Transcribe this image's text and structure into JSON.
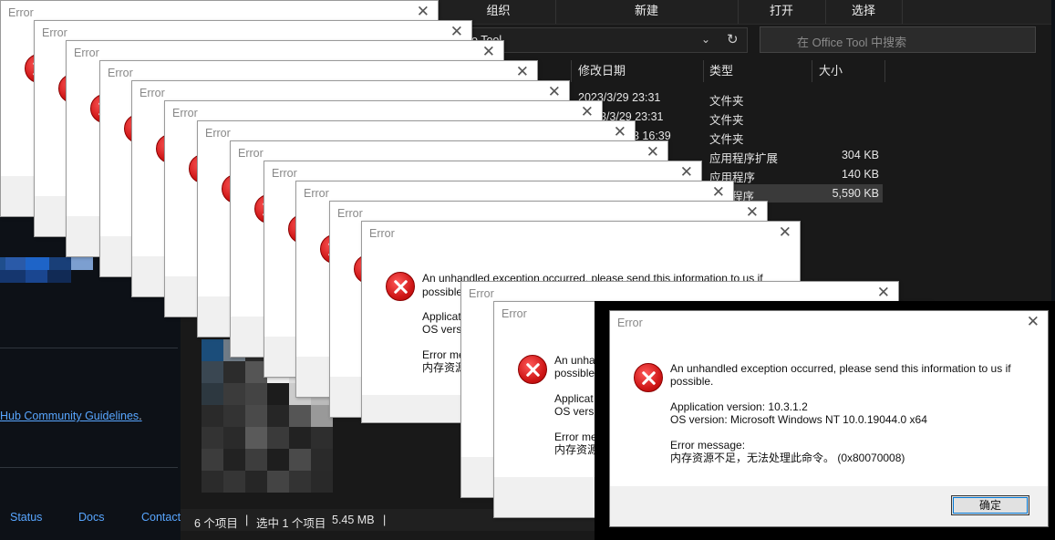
{
  "web": {
    "guideline_link": "Hub Community Guidelines",
    "guideline_dot": ".",
    "footer": [
      "Status",
      "Docs",
      "Contact"
    ]
  },
  "explorer": {
    "commands": [
      "组织",
      "新建",
      "打开",
      "选择"
    ],
    "address_text": "o Tool",
    "search_placeholder": "在 Office Tool 中搜索",
    "columns": {
      "modified": "修改日期",
      "type": "类型",
      "size": "大小"
    },
    "rows": [
      {
        "modified": "2023/3/29 23:31",
        "type": "文件夹",
        "size": ""
      },
      {
        "modified": "3/3/29 23:31",
        "type": "文件夹",
        "size": ""
      },
      {
        "modified": "3 16:39",
        "type": "文件夹",
        "size": ""
      },
      {
        "modified": "",
        "type": "应用程序扩展",
        "size": "304 KB"
      },
      {
        "modified": "",
        "type": "应用程序",
        "size": "140 KB"
      },
      {
        "modified": "",
        "type": "程序",
        "size": "5,590 KB"
      }
    ],
    "status": {
      "items": "6 个项目",
      "selected": "选中 1 个项目",
      "size": "5.45 MB",
      "sep": "|"
    }
  },
  "dialog": {
    "title": "Error",
    "line1": "An unhandled exception occurred, please send this information to us if",
    "line2": "possible.",
    "app_version": "Application version: 10.3.1.2",
    "os_version": "OS version: Microsoft Windows NT 10.0.19044.0 x64",
    "error_label": "Error message:",
    "error_text": "内存资源不足，无法处理此命令。 (0x80070008)",
    "ok_label": "确定",
    "close_glyph": "✕"
  },
  "partial": {
    "line1a": "An unhandled exception occurred, please send this information to us if",
    "possible": "possible",
    "applicat": "Applicat",
    "os_versi": "OS versi",
    "error_me": "Error me",
    "mem_short": "内存资源",
    "an_unha": "An unha",
    "possible_b": "possible",
    "applicat_b": "Applicat",
    "os_versi_b": "OS versi",
    "error_me_b": "Error me",
    "mem_short_b": "内存资源"
  },
  "colors": {
    "error_red": "#d01818",
    "link": "#58a6ff",
    "explorer_bg": "#191919"
  }
}
